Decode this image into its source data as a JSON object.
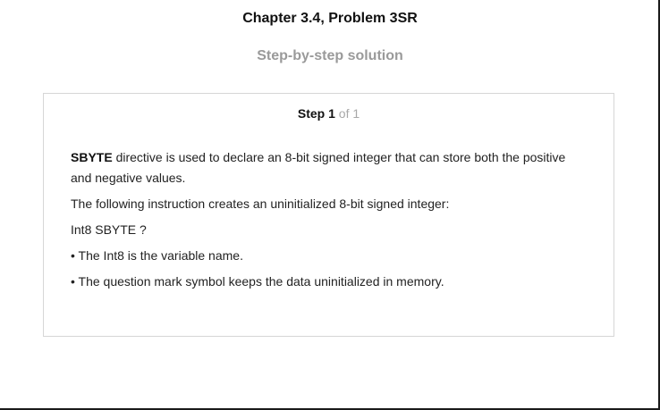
{
  "header": {
    "title": "Chapter 3.4, Problem 3SR",
    "subtitle": "Step-by-step solution"
  },
  "step": {
    "word": "Step",
    "number": "1",
    "of_text": "of 1"
  },
  "solution": {
    "para1_keyword": "SBYTE",
    "para1_text": " directive is used to declare an 8-bit signed integer that can store both the positive and negative values.",
    "para2": "The following instruction creates an uninitialized 8-bit signed integer:",
    "code_line": "Int8 SBYTE ?",
    "bullet1": "• The Int8 is the variable name.",
    "bullet2": "• The question mark symbol keeps the data uninitialized in memory."
  }
}
